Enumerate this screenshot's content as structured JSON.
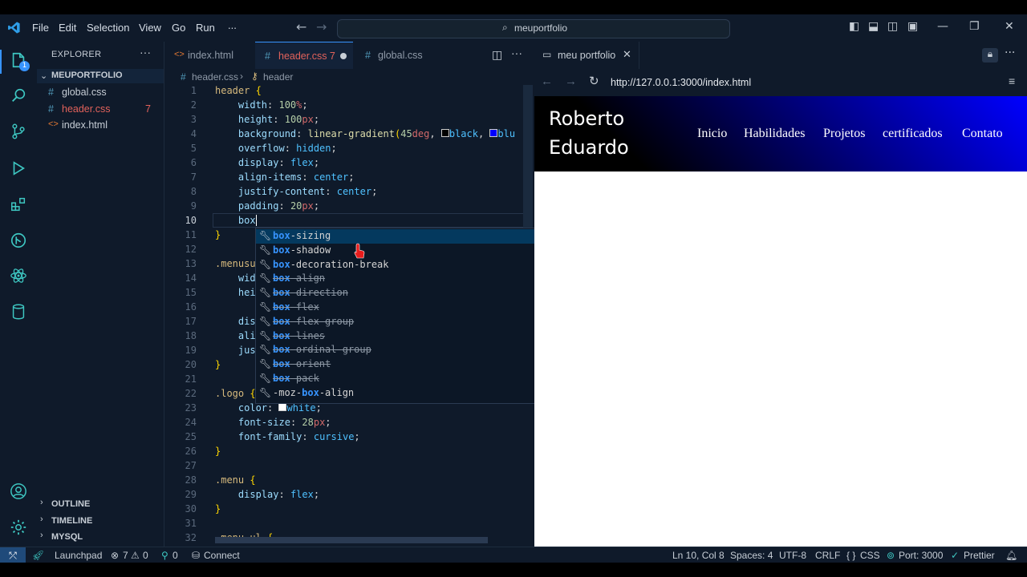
{
  "titlebar": {
    "menus": [
      "File",
      "Edit",
      "Selection",
      "View",
      "Go",
      "Run",
      "..."
    ],
    "search_text": "meuportfolio"
  },
  "activity": {
    "explorer_badge": "1"
  },
  "sidebar": {
    "title": "EXPLORER",
    "folder": "MEUPORTFOLIO",
    "files": [
      {
        "name": "global.css",
        "icon": "#",
        "color": "#519aba",
        "badge": ""
      },
      {
        "name": "header.css",
        "icon": "#",
        "color": "#e2625b",
        "badge": "7"
      },
      {
        "name": "index.html",
        "icon": "<>",
        "color": "#e37933",
        "badge": ""
      }
    ],
    "sections": [
      "OUTLINE",
      "TIMELINE",
      "MYSQL"
    ]
  },
  "tabs": [
    {
      "label": "index.html",
      "icon": "<>",
      "color": "#e37933"
    },
    {
      "label": "header.css 7",
      "icon": "#",
      "color": "#e2625b"
    },
    {
      "label": "global.css",
      "icon": "#",
      "color": "#519aba"
    }
  ],
  "breadcrumb": {
    "file": "header.css",
    "symbol": "header"
  },
  "editor": {
    "line_numbers": [
      "1",
      "2",
      "3",
      "4",
      "5",
      "6",
      "7",
      "8",
      "9",
      "10",
      "11",
      "12",
      "13",
      "14",
      "15",
      "16",
      "17",
      "18",
      "19",
      "20",
      "21",
      "22",
      "23",
      "24",
      "25",
      "26",
      "27",
      "28",
      "29",
      "30",
      "31",
      "32"
    ]
  },
  "suggest": {
    "typed": "box",
    "items": [
      {
        "pre": "",
        "match": "box",
        "post": "-sizing",
        "deprecated": false
      },
      {
        "pre": "",
        "match": "box",
        "post": "-shadow",
        "deprecated": false
      },
      {
        "pre": "",
        "match": "box",
        "post": "-decoration-break",
        "deprecated": false
      },
      {
        "pre": "",
        "match": "box",
        "post": "-align",
        "deprecated": true
      },
      {
        "pre": "",
        "match": "box",
        "post": "-direction",
        "deprecated": true
      },
      {
        "pre": "",
        "match": "box",
        "post": "-flex",
        "deprecated": true
      },
      {
        "pre": "",
        "match": "box",
        "post": "-flex-group",
        "deprecated": true
      },
      {
        "pre": "",
        "match": "box",
        "post": "-lines",
        "deprecated": true
      },
      {
        "pre": "",
        "match": "box",
        "post": "-ordinal-group",
        "deprecated": true
      },
      {
        "pre": "",
        "match": "box",
        "post": "-orient",
        "deprecated": true
      },
      {
        "pre": "",
        "match": "box",
        "post": "-pack",
        "deprecated": true
      },
      {
        "pre": "-moz-",
        "match": "box",
        "post": "-align",
        "deprecated": false
      }
    ]
  },
  "browser": {
    "tab_label": "meu portfolio",
    "url": "http://127.0.0.1:3000/index.html",
    "site": {
      "logo_line1": "Roberto",
      "logo_line2": "Eduardo",
      "nav": [
        "Inicio",
        "Habilidades",
        "Projetos",
        "certificados",
        "Contato"
      ]
    }
  },
  "status": {
    "launchpad": "Launchpad",
    "errors": "7",
    "warnings": "0",
    "ports": "0",
    "connect": "Connect",
    "position": "Ln 10, Col 8",
    "spaces": "Spaces: 4",
    "encoding": "UTF-8",
    "eol": "CRLF",
    "language": "CSS",
    "port": "Port: 3000",
    "prettier": "Prettier"
  },
  "colors": {
    "accent": "#3794ff",
    "editor_bg": "#0f1a2a"
  }
}
